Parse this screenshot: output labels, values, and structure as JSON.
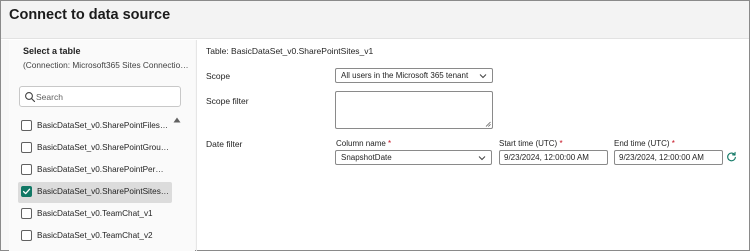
{
  "dialog": {
    "title": "Connect to data source"
  },
  "left": {
    "heading": "Select a table",
    "connection": "(Connection: Microsoft365 Sites Connection ad...",
    "search_placeholder": "Search",
    "items": [
      {
        "label": "BasicDataSet_v0.SharePointFiles_v1",
        "checked": false
      },
      {
        "label": "BasicDataSet_v0.SharePointGroups...",
        "checked": false
      },
      {
        "label": "BasicDataSet_v0.SharePointPermis...",
        "checked": false
      },
      {
        "label": "BasicDataSet_v0.SharePointSites_v1",
        "checked": true
      },
      {
        "label": "BasicDataSet_v0.TeamChat_v1",
        "checked": false
      },
      {
        "label": "BasicDataSet_v0.TeamChat_v2",
        "checked": false
      }
    ]
  },
  "right": {
    "table_title": "Table: BasicDataSet_v0.SharePointSites_v1",
    "scope_label": "Scope",
    "scope_value": "All users in the Microsoft 365 tenant",
    "scope_filter_label": "Scope filter",
    "date_filter_label": "Date filter",
    "column_name_label": "Column name",
    "column_name_value": "SnapshotDate",
    "start_time_label": "Start time (UTC)",
    "start_time_value": "9/23/2024, 12:00:00 AM",
    "end_time_label": "End time (UTC)",
    "end_time_value": "9/23/2024, 12:00:00 AM",
    "required_mark": "*"
  },
  "colors": {
    "accent": "#117865",
    "required": "#c50f1f",
    "selected_row": "#dcdcdc"
  },
  "icons": {
    "search": "search-icon",
    "chevron": "chevron-down-icon",
    "refresh": "refresh-icon",
    "scroll": "scroll-up-arrow-icon",
    "check": "checkmark-icon"
  }
}
